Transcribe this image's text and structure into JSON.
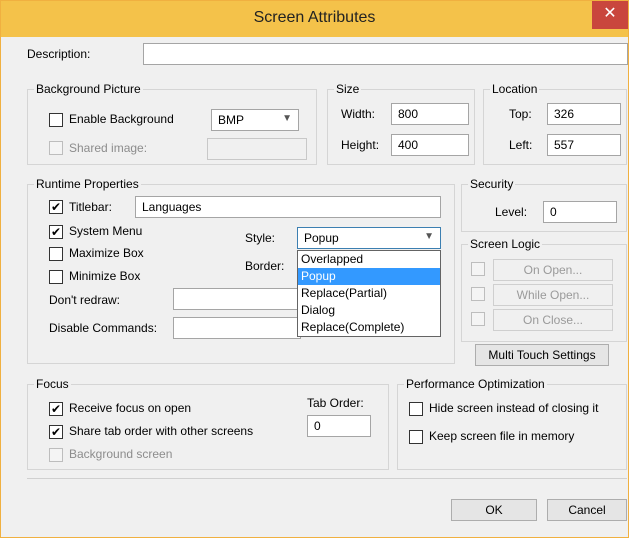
{
  "window": {
    "title": "Screen Attributes",
    "close_glyph": "✕"
  },
  "description": {
    "label": "Description:",
    "value": ""
  },
  "background_picture": {
    "group": "Background Picture",
    "enable_label": "Enable Background",
    "format": "BMP",
    "shared_label": "Shared image:",
    "shared_value": ""
  },
  "size": {
    "group": "Size",
    "width_label": "Width:",
    "width": "800",
    "height_label": "Height:",
    "height": "400"
  },
  "location": {
    "group": "Location",
    "top_label": "Top:",
    "top": "326",
    "left_label": "Left:",
    "left": "557"
  },
  "runtime": {
    "group": "Runtime Properties",
    "titlebar_label": "Titlebar:",
    "titlebar_value": "Languages",
    "system_menu": "System Menu",
    "maximize": "Maximize Box",
    "minimize": "Minimize Box",
    "dont_redraw": "Don't redraw:",
    "disable_commands": "Disable Commands:",
    "style_label": "Style:",
    "style_value": "Popup",
    "border_label": "Border:",
    "style_options": [
      "Overlapped",
      "Popup",
      "Replace(Partial)",
      "Dialog",
      "Replace(Complete)"
    ],
    "style_selected_index": 1
  },
  "security": {
    "group": "Security",
    "level_label": "Level:",
    "level": "0"
  },
  "screen_logic": {
    "group": "Screen Logic",
    "on_open": "On Open...",
    "while_open": "While Open...",
    "on_close": "On Close..."
  },
  "multi_touch": "Multi Touch Settings",
  "focus": {
    "group": "Focus",
    "receive": "Receive focus on open",
    "share": "Share tab order with other screens",
    "background": "Background screen",
    "tab_order_label": "Tab Order:",
    "tab_order": "0"
  },
  "performance": {
    "group": "Performance Optimization",
    "hide": "Hide screen instead of closing it",
    "keep": "Keep screen file in memory"
  },
  "buttons": {
    "ok": "OK",
    "cancel": "Cancel"
  },
  "colors": {
    "titlebar": "#f4c24a",
    "close": "#c9463d",
    "selection": "#3399ff"
  }
}
